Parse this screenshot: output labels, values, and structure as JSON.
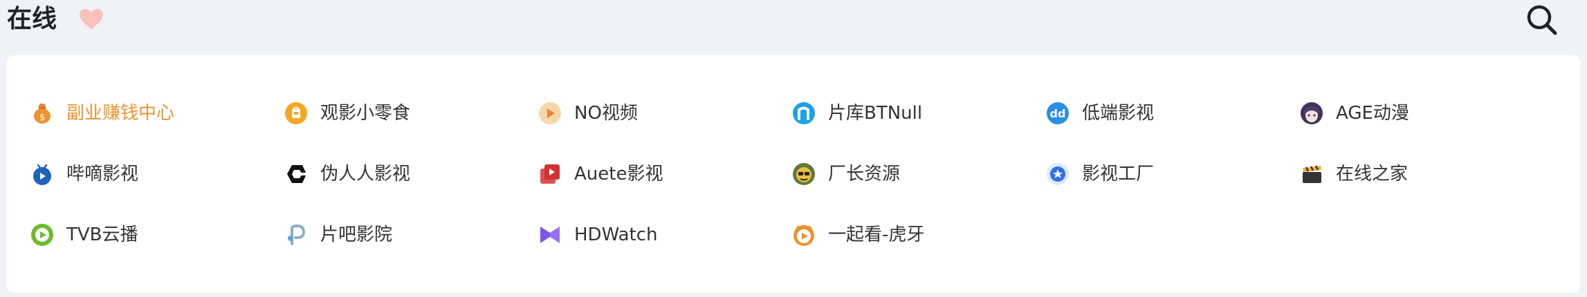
{
  "header": {
    "title": "在线",
    "heart_icon": "heart-icon",
    "search_icon": "search-icon"
  },
  "colors": {
    "accent": "#f0922d",
    "background": "#eff3f7",
    "panel": "#ffffff",
    "text": "#333333"
  },
  "sites": [
    {
      "label": "副业赚钱中心",
      "icon": "money-bag-icon",
      "active": true
    },
    {
      "label": "观影小零食",
      "icon": "snack-bag-icon"
    },
    {
      "label": "NO视频",
      "icon": "play-circle-icon"
    },
    {
      "label": "片库BTNull",
      "icon": "n-logo-icon"
    },
    {
      "label": "低端影视",
      "icon": "dd-logo-icon"
    },
    {
      "label": "AGE动漫",
      "icon": "anime-avatar-icon"
    },
    {
      "label": "哔嘀影视",
      "icon": "tv-play-icon"
    },
    {
      "label": "伪人人影视",
      "icon": "hexagon-logo-icon"
    },
    {
      "label": "Auete影视",
      "icon": "video-library-icon"
    },
    {
      "label": "厂长资源",
      "icon": "face-avatar-icon"
    },
    {
      "label": "影视工厂",
      "icon": "star-badge-icon"
    },
    {
      "label": "在线之家",
      "icon": "clapperboard-icon"
    },
    {
      "label": "TVB云播",
      "icon": "green-play-icon"
    },
    {
      "label": "片吧影院",
      "icon": "p-logo-icon"
    },
    {
      "label": "HDWatch",
      "icon": "purple-bowtie-icon"
    },
    {
      "label": "一起看-虎牙",
      "icon": "huya-logo-icon"
    }
  ]
}
